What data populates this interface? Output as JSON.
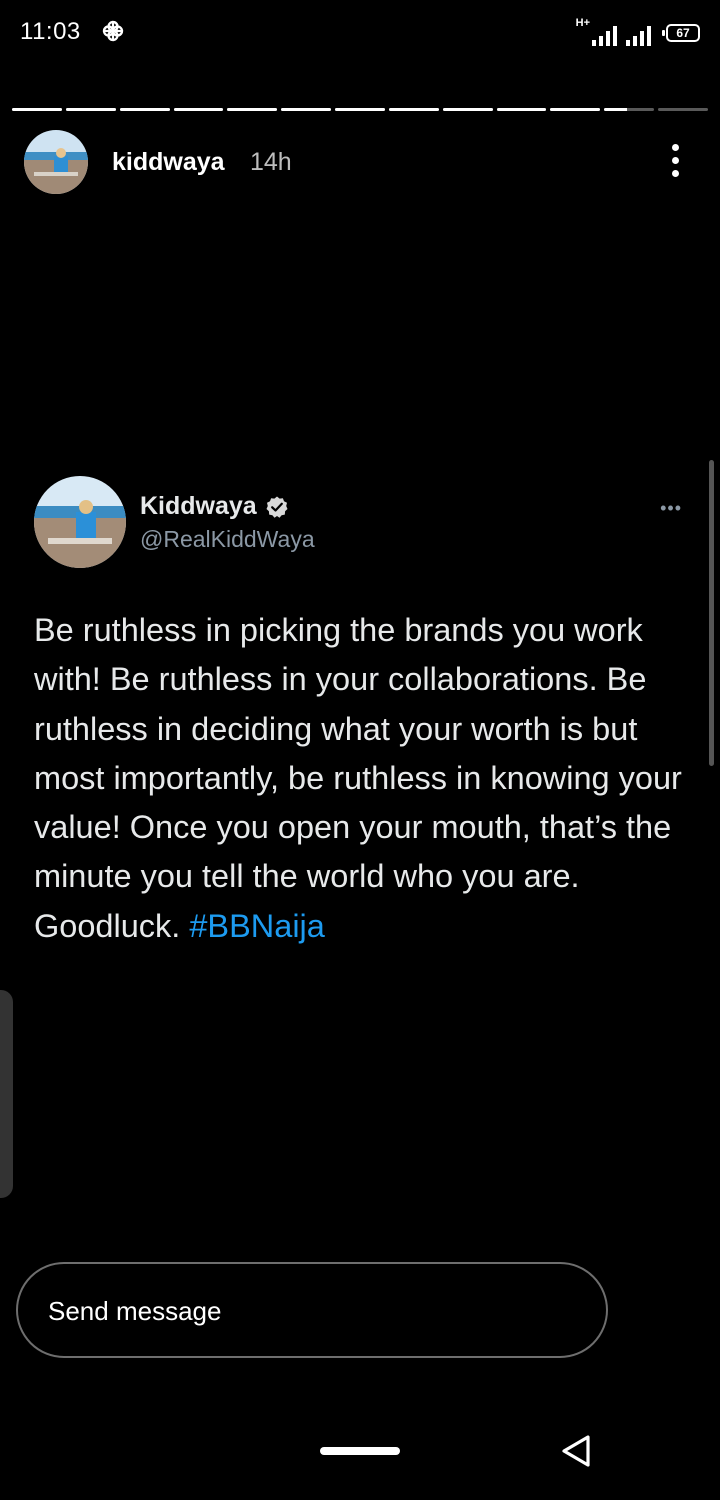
{
  "status_bar": {
    "time": "11:03",
    "network_badge": "H+",
    "battery": "67",
    "app_icon": "pinwheel-icon"
  },
  "story": {
    "progress": {
      "segments_total": 13,
      "segments_completed": 11,
      "current_segment_fraction": 0.45
    },
    "username": "kiddwaya",
    "time": "14h",
    "menu_icon": "more-vertical-icon"
  },
  "tweet": {
    "display_name": "Kiddwaya",
    "handle": "@RealKiddWaya",
    "verified": true,
    "more_icon": "more-horizontal-icon",
    "text": "Be ruthless in picking the brands you work with! Be ruthless in your collaborations. Be ruthless in deciding what your worth is but most importantly, be ruthless in knowing your value! Once you open your mouth, that’s the minute you tell the world who you are. Goodluck. ",
    "hashtag": "#BBNaija",
    "hashtag_color": "#1d9bf0"
  },
  "composer": {
    "placeholder": "Send message"
  },
  "navigation": {
    "home_icon": "home-pill-icon",
    "back_icon": "back-triangle-icon"
  }
}
